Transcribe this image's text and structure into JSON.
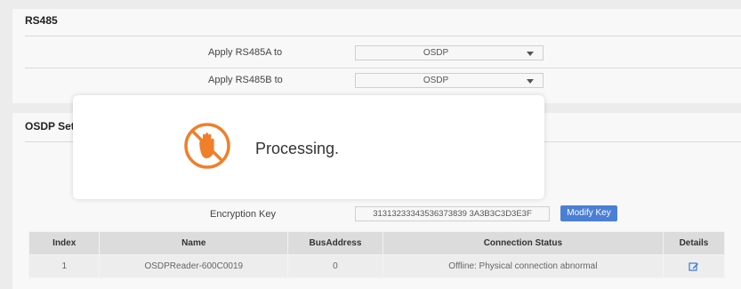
{
  "rs485": {
    "title": "RS485",
    "rows": [
      {
        "label": "Apply RS485A to",
        "value": "OSDP"
      },
      {
        "label": "Apply RS485B to",
        "value": "OSDP"
      }
    ]
  },
  "osdp": {
    "title_visible": "OSDP Setti",
    "encryption_label": "Encryption Key",
    "encryption_value": "31313233343536373839 3A3B3C3D3E3F",
    "modify_button": "Modify Key",
    "table": {
      "headers": [
        "Index",
        "Name",
        "BusAddress",
        "Connection Status",
        "Details"
      ],
      "rows": [
        [
          "1",
          "OSDPReader-600C0019",
          "0",
          "Offline: Physical connection abnormal",
          "edit-icon"
        ]
      ]
    }
  },
  "dialog": {
    "icon": "stop-hand-icon",
    "message": "Processing."
  },
  "colors": {
    "accent": "#4a7fd6",
    "warning": "#f07f2a"
  }
}
